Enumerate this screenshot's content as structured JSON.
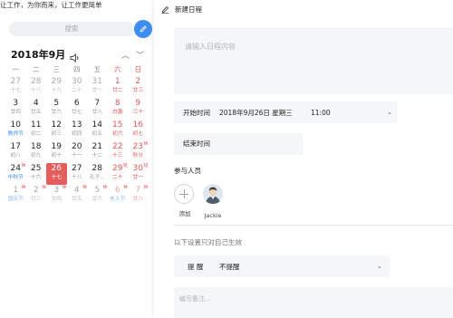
{
  "left": {
    "tagline": "让工作，为你而来，让工作更简单",
    "search_placeholder": "搜索",
    "month_title": "2018年9月",
    "weekdays": [
      "一",
      "二",
      "三",
      "四",
      "五",
      "六",
      "日"
    ],
    "weeks": [
      [
        {
          "d": "27",
          "l": "十七",
          "muted": true
        },
        {
          "d": "28",
          "l": "十八",
          "muted": true
        },
        {
          "d": "29",
          "l": "十九",
          "muted": true
        },
        {
          "d": "30",
          "l": "二十",
          "muted": true
        },
        {
          "d": "31",
          "l": "廿一",
          "muted": true
        },
        {
          "d": "1",
          "l": "廿二",
          "red": true
        },
        {
          "d": "2",
          "l": "廿三",
          "red": true
        }
      ],
      [
        {
          "d": "3",
          "l": "廿四"
        },
        {
          "d": "4",
          "l": "廿五"
        },
        {
          "d": "5",
          "l": "廿六"
        },
        {
          "d": "6",
          "l": "廿七"
        },
        {
          "d": "7",
          "l": "廿八"
        },
        {
          "d": "8",
          "l": "白露",
          "red": true
        },
        {
          "d": "9",
          "l": "三十",
          "red": true
        }
      ],
      [
        {
          "d": "10",
          "l": "教师节",
          "fest": true
        },
        {
          "d": "11",
          "l": "初二"
        },
        {
          "d": "12",
          "l": "初三"
        },
        {
          "d": "13",
          "l": "初四"
        },
        {
          "d": "14",
          "l": "初五"
        },
        {
          "d": "15",
          "l": "初六",
          "red": true
        },
        {
          "d": "16",
          "l": "初七",
          "red": true
        }
      ],
      [
        {
          "d": "17",
          "l": "初八"
        },
        {
          "d": "18",
          "l": "初九"
        },
        {
          "d": "19",
          "l": "初十"
        },
        {
          "d": "20",
          "l": "十一"
        },
        {
          "d": "21",
          "l": "十二"
        },
        {
          "d": "22",
          "l": "十三",
          "red": true
        },
        {
          "d": "23",
          "l": "秋分",
          "red": true,
          "tag": "休"
        }
      ],
      [
        {
          "d": "24",
          "l": "中秋节",
          "fest": true,
          "tag": "休"
        },
        {
          "d": "25",
          "l": "十六"
        },
        {
          "d": "26",
          "l": "十七",
          "sel": true
        },
        {
          "d": "27",
          "l": "十八"
        },
        {
          "d": "28",
          "l": "孔子..."
        },
        {
          "d": "29",
          "l": "二十",
          "red": true,
          "tag": "班"
        },
        {
          "d": "30",
          "l": "廿一",
          "red": true,
          "tag": "班"
        }
      ],
      [
        {
          "d": "1",
          "l": "国庆节",
          "muted": true,
          "fest": true,
          "tag": "休"
        },
        {
          "d": "2",
          "l": "廿三",
          "muted": true,
          "tag": "休"
        },
        {
          "d": "3",
          "l": "廿四",
          "muted": true,
          "tag": "休"
        },
        {
          "d": "4",
          "l": "廿五",
          "muted": true,
          "tag": "休"
        },
        {
          "d": "5",
          "l": "廿六",
          "muted": true,
          "tag": "休"
        },
        {
          "d": "6",
          "l": "老人节",
          "muted": true,
          "red": true,
          "fest": true,
          "tag": "休"
        },
        {
          "d": "7",
          "l": "廿八",
          "muted": true,
          "red": true,
          "tag": "休"
        }
      ]
    ]
  },
  "right": {
    "header_title": "新建日程",
    "title_placeholder": "请输入日程内容",
    "start_label": "开始时间",
    "start_date": "2018年9月26日 星期三",
    "start_time": "11:00",
    "end_label": "结束时间",
    "participants_label": "参与人员",
    "add_label": "添加",
    "person_name": "Jackie",
    "only_self_note": "以下设置只对自己生效",
    "remind_label": "提 醒",
    "remind_value": "不提醒",
    "note_placeholder": "编写备注..."
  },
  "colors": {
    "accent": "#3d8ef0",
    "weekend_red": "#e0585a",
    "selected_bg": "#e45d5d",
    "field_bg": "#f5f6f8"
  }
}
